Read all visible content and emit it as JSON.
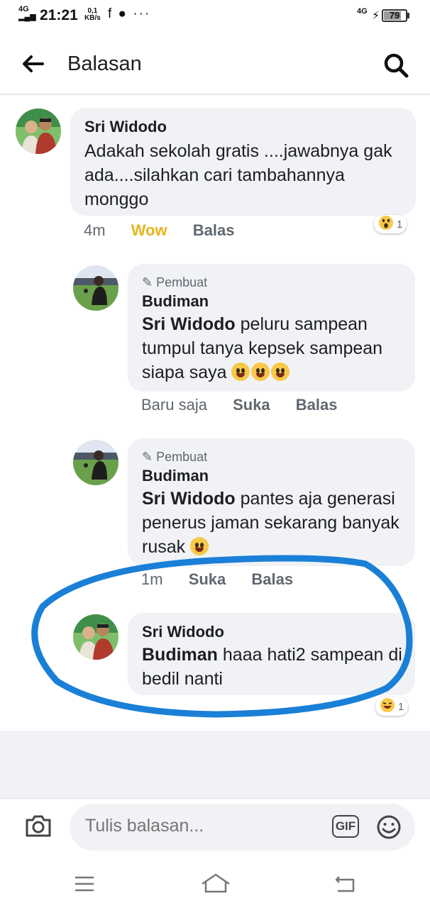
{
  "status_bar": {
    "network_left": "4G",
    "time": "21:21",
    "speed_value": "0,1",
    "speed_unit": "KB/s",
    "notif_icons": "f ● ···",
    "network_right": "4G",
    "battery": "79",
    "battery_level": 0.79
  },
  "header": {
    "title": "Balasan"
  },
  "comments": [
    {
      "author": "Sri Widodo",
      "text": "Adakah sekolah gratis ....jawabnya gak ada....silahkan cari tambahannya monggo",
      "time": "4m",
      "reaction_label": "Wow",
      "reply_label": "Balas",
      "reaction_count": "1",
      "reaction_icon": "wow-emoji-icon",
      "avatar_colors": [
        "#2e8b57",
        "#c0392b"
      ]
    },
    {
      "creator_badge": "Pembuat",
      "author": "Budiman",
      "mention": "Sri Widodo",
      "text": " peluru sampean tumpul tanya kepsek sampean siapa saya",
      "emoji_count": 3,
      "time": "Baru saja",
      "like_label": "Suka",
      "reply_label": "Balas"
    },
    {
      "creator_badge": "Pembuat",
      "author": "Budiman",
      "mention": "Sri Widodo",
      "text": " pantes aja generasi penerus jaman sekarang banyak rusak",
      "time": "1m",
      "like_label": "Suka",
      "reply_label": "Balas"
    },
    {
      "author": "Sri Widodo",
      "mention": "Budiman",
      "text": " haaa hati2 sampean di bedil nanti",
      "reaction_count": "1",
      "reaction_icon": "laugh-emoji-icon"
    }
  ],
  "composer": {
    "placeholder": "Tulis balasan...",
    "gif_label": "GIF"
  },
  "highlight": {
    "color": "#1a7fd6"
  }
}
